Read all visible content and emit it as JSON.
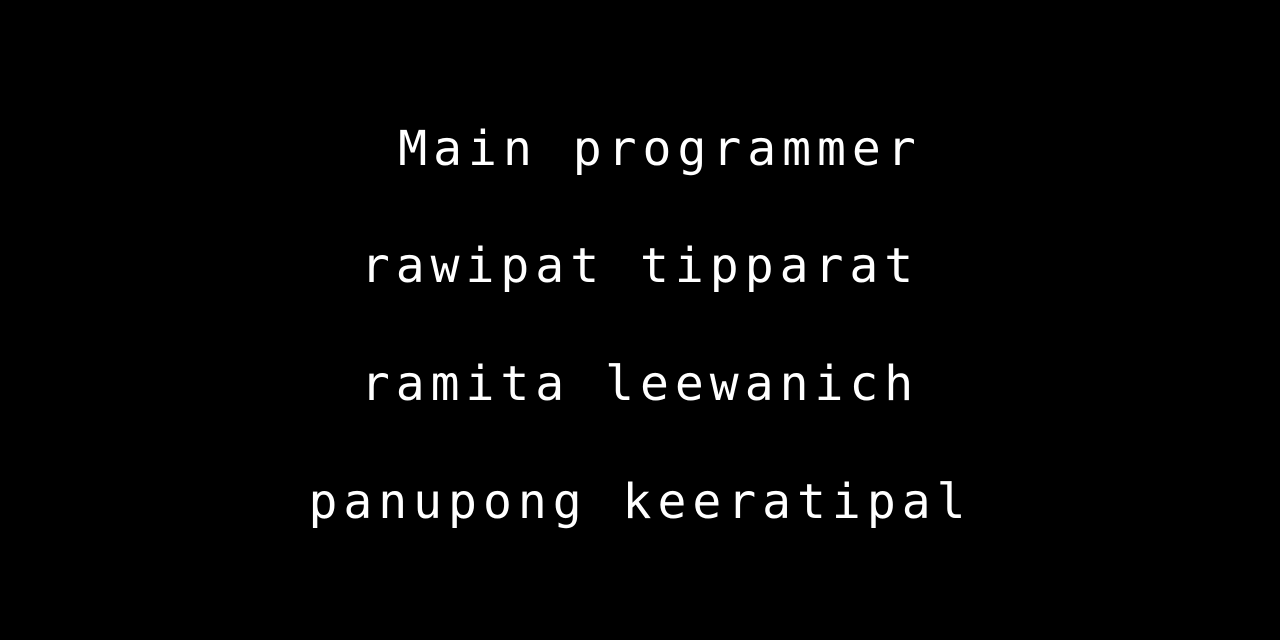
{
  "credits": {
    "heading": "Main programmer",
    "names": [
      "rawipat tipparat",
      "ramita leewanich",
      "panupong keeratipal"
    ]
  },
  "colors": {
    "background": "#000000",
    "text": "#ffffff"
  }
}
